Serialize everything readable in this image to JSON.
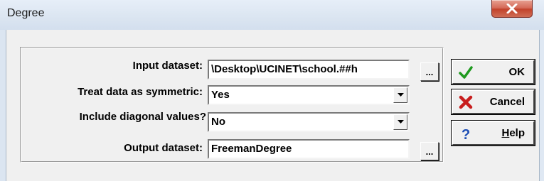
{
  "window": {
    "title": "Degree"
  },
  "form": {
    "input_dataset": {
      "label": "Input dataset:",
      "value": "\\Desktop\\UCINET\\school.##h"
    },
    "symmetric": {
      "label": "Treat data as symmetric:",
      "value": "Yes"
    },
    "diagonal": {
      "label": "Include diagonal values?",
      "value": "No"
    },
    "output_dataset": {
      "label": "Output dataset:",
      "value": "FreemanDegree"
    },
    "browse_label": "..."
  },
  "buttons": {
    "ok": "OK",
    "cancel": "Cancel",
    "help_prefix": "H",
    "help_rest": "elp"
  },
  "colors": {
    "ok_check": "#1f9a1f",
    "cancel_x": "#c81e1e",
    "help_q": "#1f4fb5"
  }
}
